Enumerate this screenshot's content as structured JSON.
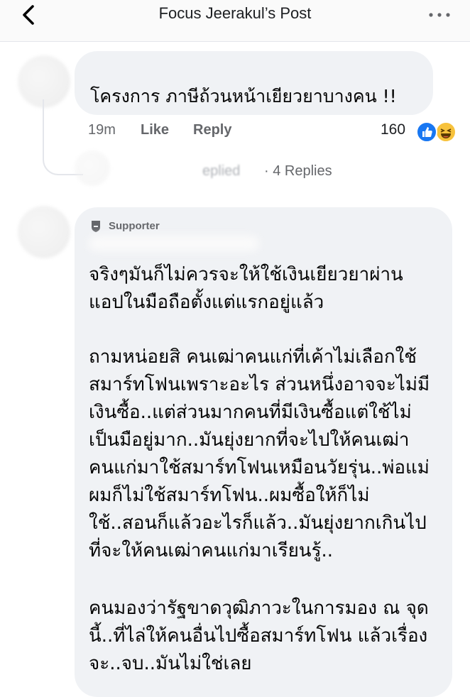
{
  "header": {
    "title": "Focus Jeerakul’s Post"
  },
  "comment1": {
    "text": "โครงการ ภาษีถ้วนหน้าเยียวยาบางคน  !!",
    "time": "19m",
    "like_label": "Like",
    "reply_label": "Reply",
    "reaction_count": "160",
    "reactions": [
      "like-icon",
      "haha-icon"
    ],
    "replied_partial": "eplied",
    "replies_link": "· 4 Replies"
  },
  "comment2": {
    "badge": "Supporter",
    "paragraphs": [
      [
        "จริงๆมันก็ไม่ควรจะให้ใช้เงินเยียวยาผ่าน",
        "แอปในมือถือตั้งแต่แรกอยู่แล้ว"
      ],
      [
        "ถามหน่อยสิ คนเฒ่าคนแก่ที่เค้าไม่เลือกใช้",
        "สมาร์ทโฟนเพราะอะไร ส่วนหนึ่งอาจจะไม่มี",
        "เงินซื้อ..แต่ส่วนมากคนที่มีเงินซื้อแต่ใช้ไม่",
        "เป็นมือยู่มาก..มันยุ่งยากที่จะไปให้คนเฒ่า",
        "คนแก่มาใช้สมาร์ทโฟนเหมือนวัยรุ่น..พ่อแม่",
        "ผมก็ไม่ใช้สมาร์ทโฟน..ผมซื้อให้ก็ไม่",
        "ใช้..สอนก็แล้วอะไรก็แล้ว..มันยุ่งยากเกินไป",
        "ที่จะให้คนเฒ่าคนแก่มาเรียนรู้.."
      ],
      [
        "คนมองว่ารัฐขาดวุฒิภาวะในการมอง ณ จุด",
        "นี้..ที่ไล่ให้คนอื่นไปซื้อสมาร์ทโฟน แล้วเรื่อง",
        "จะ..จบ..มันไม่ใช่เลย"
      ]
    ]
  }
}
